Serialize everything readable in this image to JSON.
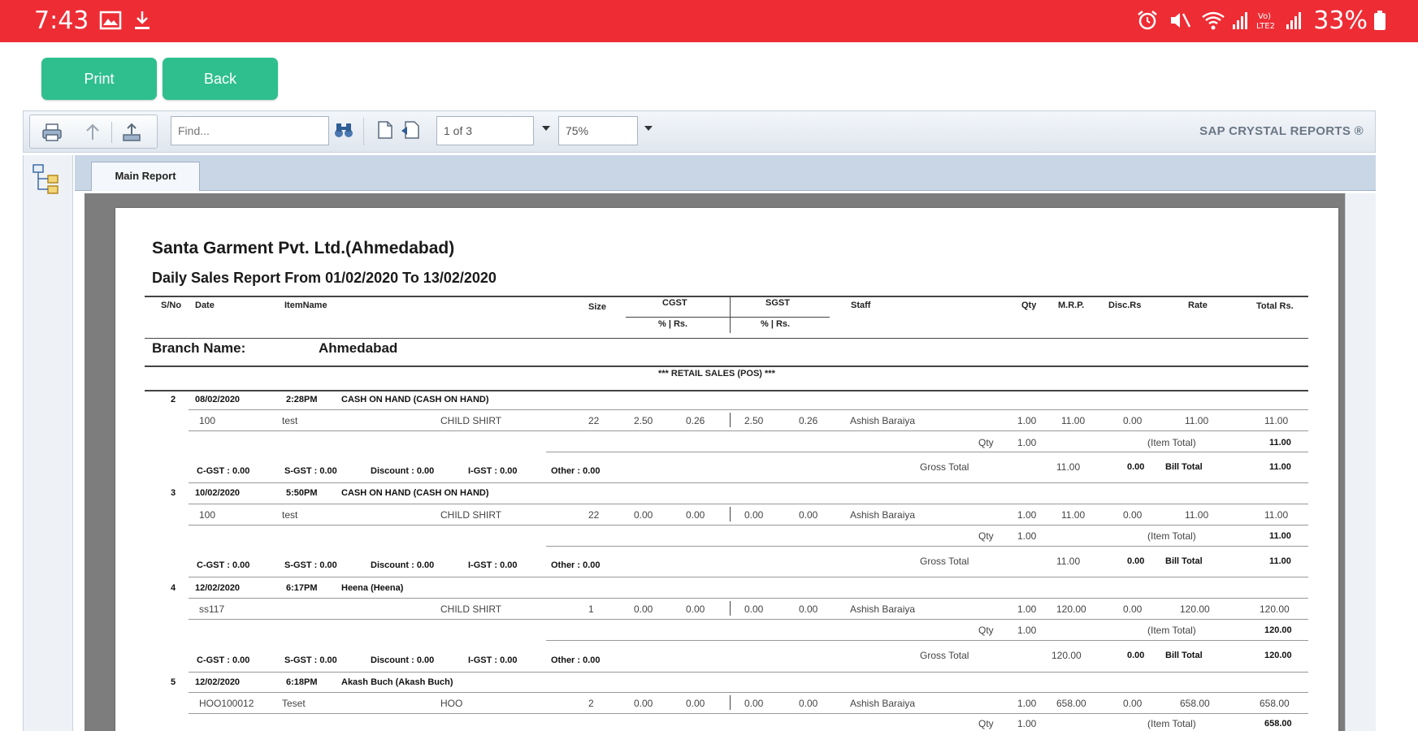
{
  "status_bar": {
    "time": "7:43",
    "battery": "33%",
    "network": "Vo) LTE2"
  },
  "buttons": {
    "print": "Print",
    "back": "Back"
  },
  "toolbar": {
    "find_placeholder": "Find...",
    "page_indicator": "1 of 3",
    "zoom": "75%",
    "brand": "SAP CRYSTAL REPORTS ®"
  },
  "tabs": {
    "main": "Main Report"
  },
  "report": {
    "company": "Santa Garment Pvt. Ltd.(Ahmedabad)",
    "title": "Daily Sales Report From 01/02/2020 To 13/02/2020",
    "headers": {
      "srno": "S/No",
      "date": "Date",
      "item": "ItemName",
      "size": "Size",
      "cgst": "CGST",
      "sgst": "SGST",
      "pct_rs": "% | Rs.",
      "staff": "Staff",
      "qty": "Qty",
      "mrp": "M.R.P.",
      "disc": "Disc.Rs",
      "rate": "Rate",
      "total": "Total Rs."
    },
    "branch_label": "Branch Name:",
    "branch_value": "Ahmedabad",
    "section": "*** RETAIL SALES (POS) ***",
    "bills": [
      {
        "no": "2",
        "date": "08/02/2020",
        "time": "2:28PM",
        "customer": "CASH ON HAND (CASH ON HAND)",
        "item": {
          "code": "100",
          "name": "test",
          "category": "CHILD SHIRT",
          "size": "22",
          "cgst_pct": "2.50",
          "cgst_rs": "0.26",
          "sgst_pct": "2.50",
          "sgst_rs": "0.26",
          "staff": "Ashish Baraiya",
          "qty": "1.00",
          "mrp": "11.00",
          "disc": "0.00",
          "rate": "11.00",
          "total": "11.00"
        },
        "qty_label": "Qty",
        "qty_total": "1.00",
        "item_total_label": "(Item Total)",
        "item_total": "11.00",
        "cgst": "C-GST : 0.00",
        "sgst": "S-GST : 0.00",
        "discount": "Discount : 0.00",
        "igst": "I-GST : 0.00",
        "other": "Other : 0.00",
        "gross_label": "Gross Total",
        "gross": "11.00",
        "gross_disc": "0.00",
        "bill_label": "Bill Total",
        "bill_total": "11.00"
      },
      {
        "no": "3",
        "date": "10/02/2020",
        "time": "5:50PM",
        "customer": "CASH ON HAND (CASH ON HAND)",
        "item": {
          "code": "100",
          "name": "test",
          "category": "CHILD SHIRT",
          "size": "22",
          "cgst_pct": "0.00",
          "cgst_rs": "0.00",
          "sgst_pct": "0.00",
          "sgst_rs": "0.00",
          "staff": "Ashish Baraiya",
          "qty": "1.00",
          "mrp": "11.00",
          "disc": "0.00",
          "rate": "11.00",
          "total": "11.00"
        },
        "qty_label": "Qty",
        "qty_total": "1.00",
        "item_total_label": "(Item Total)",
        "item_total": "11.00",
        "cgst": "C-GST : 0.00",
        "sgst": "S-GST : 0.00",
        "discount": "Discount : 0.00",
        "igst": "I-GST : 0.00",
        "other": "Other : 0.00",
        "gross_label": "Gross Total",
        "gross": "11.00",
        "gross_disc": "0.00",
        "bill_label": "Bill Total",
        "bill_total": "11.00"
      },
      {
        "no": "4",
        "date": "12/02/2020",
        "time": "6:17PM",
        "customer": "Heena (Heena)",
        "item": {
          "code": "ss117",
          "name": "",
          "category": "CHILD SHIRT",
          "size": "1",
          "cgst_pct": "0.00",
          "cgst_rs": "0.00",
          "sgst_pct": "0.00",
          "sgst_rs": "0.00",
          "staff": "Ashish Baraiya",
          "qty": "1.00",
          "mrp": "120.00",
          "disc": "0.00",
          "rate": "120.00",
          "total": "120.00"
        },
        "qty_label": "Qty",
        "qty_total": "1.00",
        "item_total_label": "(Item Total)",
        "item_total": "120.00",
        "cgst": "C-GST : 0.00",
        "sgst": "S-GST : 0.00",
        "discount": "Discount : 0.00",
        "igst": "I-GST : 0.00",
        "other": "Other : 0.00",
        "gross_label": "Gross Total",
        "gross": "120.00",
        "gross_disc": "0.00",
        "bill_label": "Bill Total",
        "bill_total": "120.00"
      },
      {
        "no": "5",
        "date": "12/02/2020",
        "time": "6:18PM",
        "customer": "Akash Buch (Akash Buch)",
        "item": {
          "code": "HOO100012",
          "name": "Teset",
          "category": "HOO",
          "size": "2",
          "cgst_pct": "0.00",
          "cgst_rs": "0.00",
          "sgst_pct": "0.00",
          "sgst_rs": "0.00",
          "staff": "Ashish Baraiya",
          "qty": "1.00",
          "mrp": "658.00",
          "disc": "0.00",
          "rate": "658.00",
          "total": "658.00"
        },
        "qty_label": "Qty",
        "qty_total": "1.00",
        "item_total_label": "(Item Total)",
        "item_total": "658.00"
      }
    ]
  }
}
